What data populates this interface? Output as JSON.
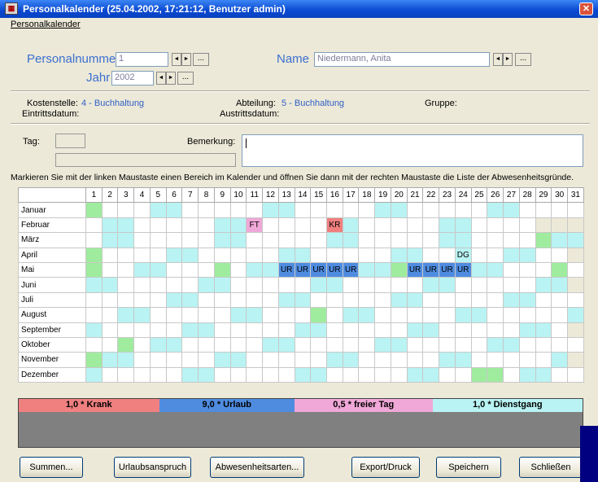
{
  "window": {
    "title": "Personalkalender (25.04.2002, 17:21:12, Benutzer admin)",
    "icon": "app-icon",
    "close_label": "✕"
  },
  "menu": {
    "items": [
      "Personalkalender"
    ]
  },
  "header": {
    "personalnummer_label": "Personalnummer",
    "personalnummer_value": "1",
    "jahr_label": "Jahr",
    "jahr_value": "2002",
    "name_label": "Name",
    "name_value": "Niedermann, Anita",
    "nav_prev": "◄",
    "nav_next": "►",
    "dots": "..."
  },
  "info": {
    "kostenstelle_label": "Kostenstelle:",
    "kostenstelle_value": "4 - Buchhaltung",
    "abteilung_label": "Abteilung:",
    "abteilung_value": "5 - Buchhaltung",
    "gruppe_label": "Gruppe:",
    "eintritt_label": "Eintrittsdatum:",
    "austritt_label": "Austrittsdatum:",
    "tag_label": "Tag:",
    "bemerkung_label": "Bemerkung:"
  },
  "instruction": "Markieren Sie mit der linken Maustaste einen Bereich im Kalender und öffnen Sie dann mit der rechten Maustaste die Liste der Abwesenheitsgründe.",
  "calendar": {
    "days": [
      "1",
      "2",
      "3",
      "4",
      "5",
      "6",
      "7",
      "8",
      "9",
      "10",
      "11",
      "12",
      "13",
      "14",
      "15",
      "16",
      "17",
      "18",
      "19",
      "20",
      "21",
      "22",
      "23",
      "24",
      "25",
      "26",
      "27",
      "28",
      "29",
      "30",
      "31"
    ],
    "months": [
      "Januar",
      "Februar",
      "März",
      "April",
      "Mai",
      "Juni",
      "Juli",
      "August",
      "September",
      "Oktober",
      "November",
      "Dezember"
    ],
    "weekend_start_day": [
      5,
      2,
      2,
      6,
      4,
      1,
      6,
      3,
      7,
      5,
      2,
      7
    ],
    "month_lengths": [
      31,
      28,
      31,
      30,
      31,
      30,
      31,
      31,
      30,
      31,
      30,
      31
    ],
    "entries": [
      {
        "month": 2,
        "day": 11,
        "code": "FT"
      },
      {
        "month": 2,
        "day": 16,
        "code": "KR"
      },
      {
        "month": 4,
        "day": 24,
        "code": "DG"
      },
      {
        "month": 5,
        "day": 13,
        "code": "UR"
      },
      {
        "month": 5,
        "day": 14,
        "code": "UR"
      },
      {
        "month": 5,
        "day": 15,
        "code": "UR"
      },
      {
        "month": 5,
        "day": 16,
        "code": "UR"
      },
      {
        "month": 5,
        "day": 17,
        "code": "UR"
      },
      {
        "month": 5,
        "day": 21,
        "code": "UR"
      },
      {
        "month": 5,
        "day": 22,
        "code": "UR"
      },
      {
        "month": 5,
        "day": 23,
        "code": "UR"
      },
      {
        "month": 5,
        "day": 24,
        "code": "UR"
      }
    ],
    "holidays": [
      {
        "month": 1,
        "day": 1
      },
      {
        "month": 3,
        "day": 29
      },
      {
        "month": 4,
        "day": 1
      },
      {
        "month": 5,
        "day": 1
      },
      {
        "month": 5,
        "day": 9
      },
      {
        "month": 5,
        "day": 20
      },
      {
        "month": 5,
        "day": 30
      },
      {
        "month": 8,
        "day": 15
      },
      {
        "month": 10,
        "day": 3
      },
      {
        "month": 11,
        "day": 1
      },
      {
        "month": 12,
        "day": 25
      },
      {
        "month": 12,
        "day": 26
      }
    ]
  },
  "legend": [
    {
      "label": "1,0 * Krank",
      "color": "#f08080"
    },
    {
      "label": "9,0 * Urlaub",
      "color": "#4f8ce0"
    },
    {
      "label": "0,5 * freier Tag",
      "color": "#f0a8d8"
    },
    {
      "label": "1,0 * Dienstgang",
      "color": "#b9f3f3"
    }
  ],
  "buttons": {
    "summen": "Summen...",
    "urlaubsanspruch": "Urlaubsanspruch",
    "abwesenheitsarten": "Abwesenheitsarten...",
    "export": "Export/Druck",
    "speichern": "Speichern",
    "schliessen": "Schließen"
  },
  "colors": {
    "titlebar": "#0a48d0",
    "weekend": "#b9f3f3",
    "holiday": "#9fec9f",
    "urlaub": "#4f8ce0",
    "krank": "#f08080",
    "freier_tag": "#f0a8d8"
  }
}
